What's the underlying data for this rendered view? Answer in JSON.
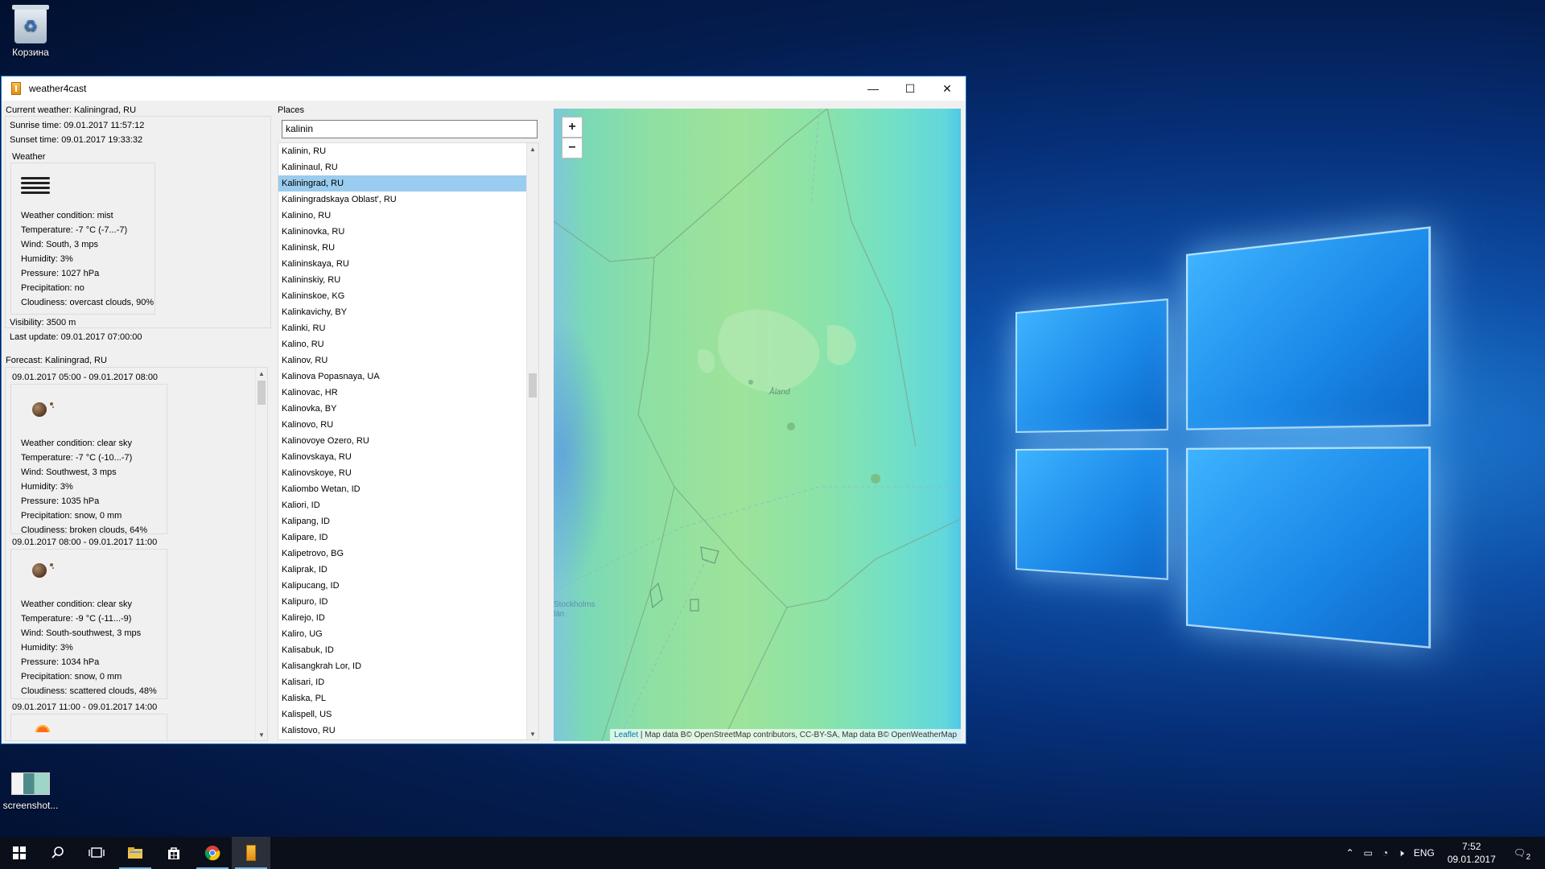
{
  "desktop": {
    "recycle_bin_label": "Корзина",
    "screenshot_label": "screenshot..."
  },
  "window": {
    "title": "weather4cast",
    "minimize": "—",
    "maximize": "☐",
    "close": "✕"
  },
  "current": {
    "header": "Current weather: Kaliningrad, RU",
    "sunrise": "Sunrise time: 09.01.2017 11:57:12",
    "sunset": "Sunset  time: 09.01.2017 19:33:32",
    "weather_label": "Weather",
    "icon": "mist-icon",
    "condition": "Weather condition: mist",
    "temperature": "Temperature: -7 °C (-7...-7)",
    "wind": "Wind: South, 3 mps",
    "humidity": "Humidity: 3%",
    "pressure": "Pressure: 1027 hPa",
    "precipitation": "Precipitation: no",
    "cloudiness": "Cloudiness: overcast clouds, 90%",
    "visibility": "Visibility: 3500 m",
    "last_update": "Last update: 09.01.2017 07:00:00"
  },
  "forecast": {
    "header": "Forecast: Kaliningrad, RU",
    "periods": [
      {
        "time": "09.01.2017 05:00 - 09.01.2017 08:00",
        "condition": "Weather condition: clear sky",
        "temperature": "Temperature: -7 °C (-10...-7)",
        "wind": "Wind: Southwest, 3 mps",
        "humidity": "Humidity: 3%",
        "pressure": "Pressure: 1035 hPa",
        "precipitation": "Precipitation: snow, 0 mm",
        "cloudiness": "Cloudiness: broken clouds, 64%"
      },
      {
        "time": "09.01.2017 08:00 - 09.01.2017 11:00",
        "condition": "Weather condition: clear sky",
        "temperature": "Temperature: -9 °C (-11...-9)",
        "wind": "Wind: South-southwest, 3 mps",
        "humidity": "Humidity: 3%",
        "pressure": "Pressure: 1034 hPa",
        "precipitation": "Precipitation: snow, 0 mm",
        "cloudiness": "Cloudiness: scattered clouds, 48%"
      },
      {
        "time": "09.01.2017 11:00 - 09.01.2017 14:00"
      }
    ]
  },
  "places": {
    "label": "Places",
    "search_value": "kalinin",
    "selected_index": 2,
    "items": [
      "Kalinin, RU",
      "Kalininaul, RU",
      "Kaliningrad, RU",
      "Kaliningradskaya Oblast', RU",
      "Kalinino, RU",
      "Kalininovka, RU",
      "Kalininsk, RU",
      "Kalininskaya, RU",
      "Kalininskiy, RU",
      "Kalininskoe, KG",
      "Kalinkavichy, BY",
      "Kalinki, RU",
      "Kalino, RU",
      "Kalinov, RU",
      "Kalinova Popasnaya, UA",
      "Kalinovac, HR",
      "Kalinovka, BY",
      "Kalinovo, RU",
      "Kalinovoye Ozero, RU",
      "Kalinovskaya, RU",
      "Kalinovskoye, RU",
      "Kaliombo Wetan, ID",
      "Kaliori, ID",
      "Kalipang, ID",
      "Kalipare, ID",
      "Kalipetrovo, BG",
      "Kaliprak, ID",
      "Kalipucang, ID",
      "Kalipuro, ID",
      "Kalirejo, ID",
      "Kaliro, UG",
      "Kalisabuk, ID",
      "Kalisangkrah Lor, ID",
      "Kalisari, ID",
      "Kaliska, PL",
      "Kalispell, US",
      "Kalistovo, RU"
    ]
  },
  "map": {
    "zoom_in": "+",
    "zoom_out": "−",
    "labels": {
      "aland": "Åland",
      "stockholm": "Stockholms län"
    },
    "attribution_link": "Leaflet",
    "attribution_text": " | Map data B© OpenStreetMap contributors, CC-BY-SA, Map data B© OpenWeatherMap"
  },
  "taskbar": {
    "lang": "ENG",
    "time": "7:52",
    "date": "09.01.2017",
    "notifications": "2"
  }
}
